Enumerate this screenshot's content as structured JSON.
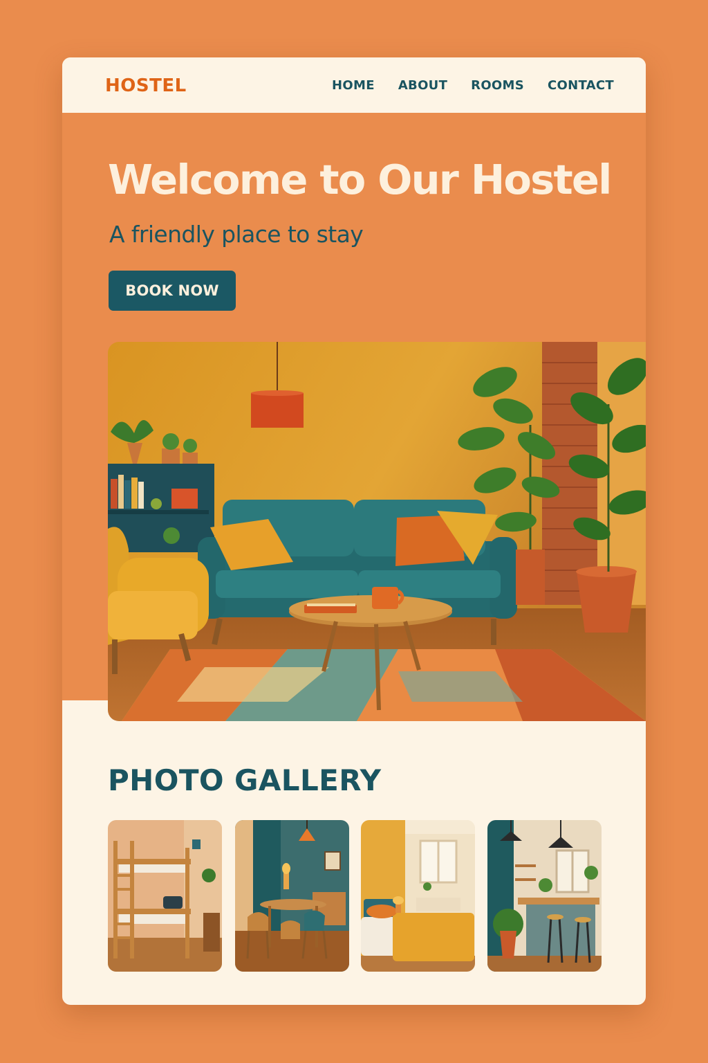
{
  "header": {
    "logo": "HOSTEL",
    "nav": [
      {
        "label": "HOME"
      },
      {
        "label": "ABOUT"
      },
      {
        "label": "ROOMS"
      },
      {
        "label": "CONTACT"
      }
    ]
  },
  "hero": {
    "title": "Welcome to Our Hostel",
    "subtitle": "A friendly place to stay",
    "cta_label": "BOOK NOW",
    "image_icon": "living-room-photo"
  },
  "gallery": {
    "title": "PHOTO GALLERY",
    "photos": [
      {
        "icon": "bunk-bed-room-photo"
      },
      {
        "icon": "dining-room-photo"
      },
      {
        "icon": "bedroom-photo"
      },
      {
        "icon": "kitchen-photo"
      }
    ]
  },
  "colors": {
    "page_background": "#ea8c4d",
    "card_background": "#fdf4e5",
    "accent_orange": "#df6417",
    "teal": "#1b5864",
    "mustard": "#e6a332"
  }
}
